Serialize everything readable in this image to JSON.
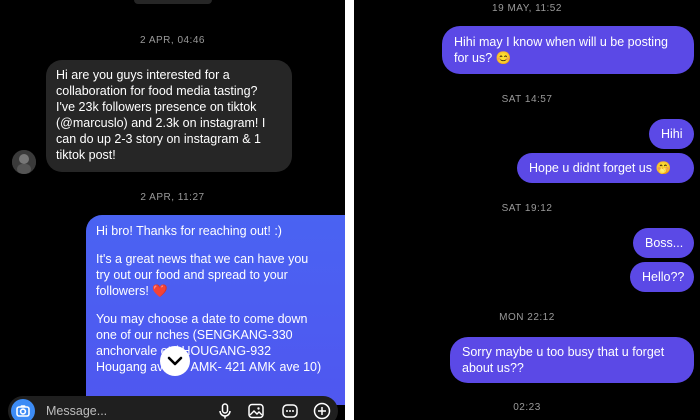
{
  "left": {
    "timestamp_1": "2 APR, 04:46",
    "incoming_message": [
      "Hi are you guys interested for a",
      "collaboration for food media tasting?",
      "I've 23k followers presence on tiktok",
      "(@marcuslo) and 2.3k on instagram! I",
      "can do up 2-3 story on instagram & 1",
      "tiktok post!"
    ],
    "timestamp_2": "2 APR, 11:27",
    "reply": {
      "p1": "Hi bro! Thanks for reaching out! :)",
      "p2": [
        "It's a great news that we can have you",
        "try out our food and spread to your",
        "followers! ❤️"
      ],
      "p3": [
        "You may choose a date to come down",
        "one of our    nches (SENGKANG-330",
        "anchorvale     et / HOUGANG-932",
        "Hougang ave 9 / AMK- 421 AMK ave 10)"
      ]
    },
    "composer_placeholder": "Message...",
    "icons": {
      "camera": "camera-icon",
      "mic": "microphone-icon",
      "gallery": "image-icon",
      "sticker": "sticker-icon",
      "add": "add-icon",
      "scroll": "chevron-down-icon"
    }
  },
  "right": {
    "timestamp_1": "19 MAY, 11:52",
    "msg_1": [
      "Hihi may I know when will u be posting",
      "for us? 😊"
    ],
    "timestamp_2": "SAT 14:57",
    "msg_2": "Hihi",
    "msg_3": "Hope u didnt forget us 🤭",
    "timestamp_3": "SAT 19:12",
    "msg_4": "Boss...",
    "msg_5": "Hello??",
    "timestamp_4": "MON 22:12",
    "msg_6": [
      "Sorry maybe u too busy that u forget",
      "about us??"
    ],
    "timestamp_5": "02:23"
  },
  "colors": {
    "background": "#000000",
    "incoming_bubble": "#262626",
    "outgoing_blue": "#4a63f2",
    "outgoing_purple": "#5b49e6",
    "divider": "#ffffff"
  }
}
